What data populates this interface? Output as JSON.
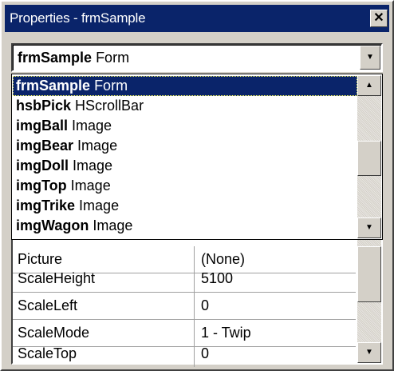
{
  "window": {
    "title": "Properties - frmSample",
    "close_glyph": "✕"
  },
  "object_combo": {
    "selected_name": "frmSample",
    "selected_type": "Form",
    "arrow_glyph": "▼"
  },
  "object_list": {
    "items": [
      {
        "name": "frmSample",
        "type": "Form",
        "selected": true
      },
      {
        "name": "hsbPick",
        "type": "HScrollBar",
        "selected": false
      },
      {
        "name": "imgBall",
        "type": "Image",
        "selected": false
      },
      {
        "name": "imgBear",
        "type": "Image",
        "selected": false
      },
      {
        "name": "imgDoll",
        "type": "Image",
        "selected": false
      },
      {
        "name": "imgTop",
        "type": "Image",
        "selected": false
      },
      {
        "name": "imgTrike",
        "type": "Image",
        "selected": false
      },
      {
        "name": "imgWagon",
        "type": "Image",
        "selected": false
      }
    ],
    "up_glyph": "▲",
    "down_glyph": "▼"
  },
  "properties": {
    "rows": [
      {
        "name": "Picture",
        "value": "(None)"
      },
      {
        "name": "ScaleHeight",
        "value": "5100"
      },
      {
        "name": "ScaleLeft",
        "value": "0"
      },
      {
        "name": "ScaleMode",
        "value": "1 - Twip"
      },
      {
        "name": "ScaleTop",
        "value": "0"
      }
    ],
    "down_glyph": "▼"
  },
  "colors": {
    "titlebar": "#0a246a",
    "selection": "#0a246a",
    "face": "#d4d0c8"
  }
}
